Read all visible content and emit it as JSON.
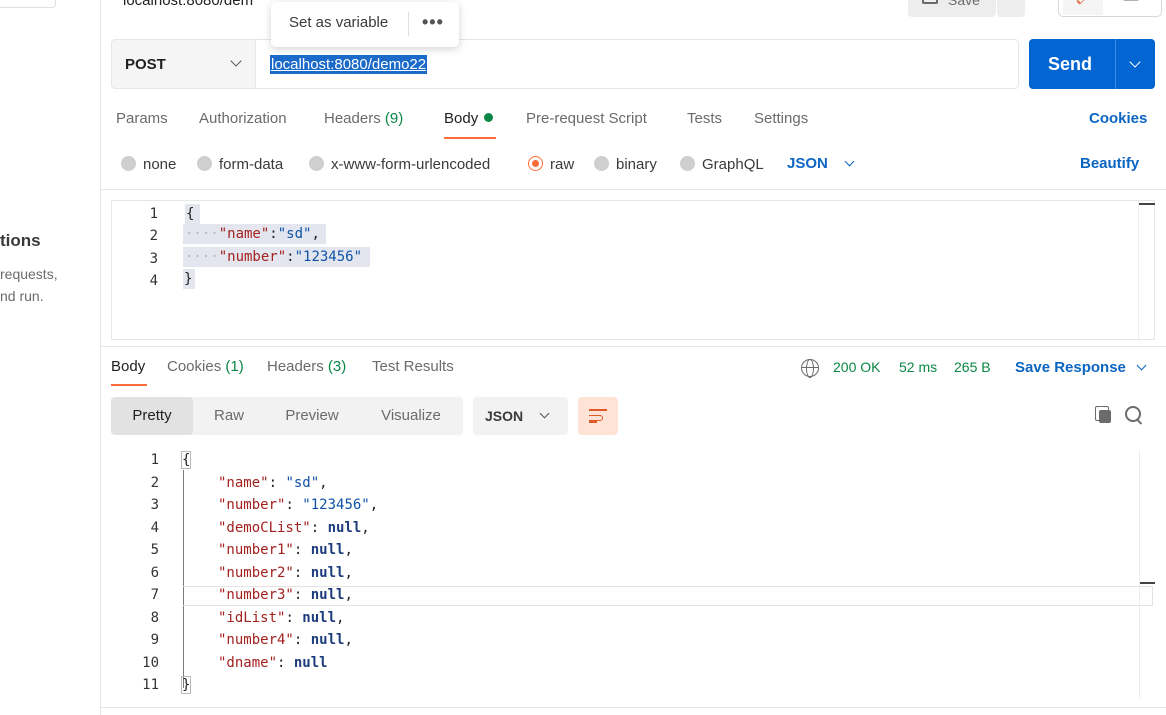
{
  "sidebar": {
    "heading": "tions",
    "line1": "requests,",
    "line2": "nd run."
  },
  "header": {
    "title": "localhost:8080/dem",
    "save_label": "Save"
  },
  "popover": {
    "set_variable": "Set as variable",
    "more": "•••"
  },
  "request": {
    "method": "POST",
    "url": "localhost:8080/demo22",
    "send_label": "Send"
  },
  "request_tabs": [
    {
      "label": "Params"
    },
    {
      "label": "Authorization"
    },
    {
      "label": "Headers",
      "count": "(9)"
    },
    {
      "label": "Body"
    },
    {
      "label": "Pre-request Script"
    },
    {
      "label": "Tests"
    },
    {
      "label": "Settings"
    }
  ],
  "cookies_label": "Cookies",
  "body_types": [
    "none",
    "form-data",
    "x-www-form-urlencoded",
    "raw",
    "binary",
    "GraphQL"
  ],
  "body_type_selected": "raw",
  "body_format": "JSON",
  "beautify_label": "Beautify",
  "request_body": {
    "line_numbers": [
      "1",
      "2",
      "3",
      "4"
    ],
    "open": "{",
    "close": "}",
    "pairs": [
      {
        "key": "\"name\"",
        "value": "\"sd\"",
        "sep": ","
      },
      {
        "key": "\"number\"",
        "value": "\"123456\"",
        "sep": ""
      }
    ]
  },
  "response_tabs": [
    {
      "label": "Body"
    },
    {
      "label": "Cookies",
      "count": "(1)"
    },
    {
      "label": "Headers",
      "count": "(3)"
    },
    {
      "label": "Test Results"
    }
  ],
  "response_status": {
    "status": "200 OK",
    "time": "52 ms",
    "size": "265 B",
    "save_response": "Save Response"
  },
  "view_modes": [
    "Pretty",
    "Raw",
    "Preview",
    "Visualize"
  ],
  "view_mode_selected": "Pretty",
  "response_format": "JSON",
  "response_body": {
    "line_numbers": [
      "1",
      "2",
      "3",
      "4",
      "5",
      "6",
      "7",
      "8",
      "9",
      "10",
      "11"
    ],
    "open": "{",
    "close": "}",
    "pairs": [
      {
        "key": "\"name\"",
        "value": "\"sd\"",
        "type": "string",
        "sep": ","
      },
      {
        "key": "\"number\"",
        "value": "\"123456\"",
        "type": "string",
        "sep": ","
      },
      {
        "key": "\"demoCList\"",
        "value": "null",
        "type": "null",
        "sep": ","
      },
      {
        "key": "\"number1\"",
        "value": "null",
        "type": "null",
        "sep": ","
      },
      {
        "key": "\"number2\"",
        "value": "null",
        "type": "null",
        "sep": ","
      },
      {
        "key": "\"number3\"",
        "value": "null",
        "type": "null",
        "sep": ","
      },
      {
        "key": "\"idList\"",
        "value": "null",
        "type": "null",
        "sep": ","
      },
      {
        "key": "\"number4\"",
        "value": "null",
        "type": "null",
        "sep": ","
      },
      {
        "key": "\"dname\"",
        "value": "null",
        "type": "null",
        "sep": ""
      }
    ]
  },
  "colors": {
    "accent": "#ff6c37",
    "send": "#0265d2",
    "link": "#0b66c3",
    "success": "#0a8744",
    "json_key": "#a3211f",
    "json_string": "#0f52a8"
  }
}
